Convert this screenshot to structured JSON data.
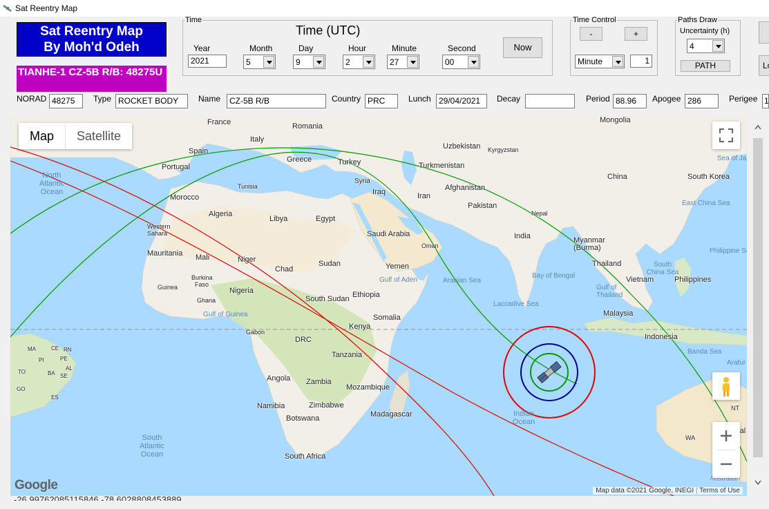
{
  "window": {
    "title": "Sat Reentry Map"
  },
  "header": {
    "app_title_line1": "Sat Reentry Map",
    "app_title_line2": "By Moh'd Odeh",
    "satellite": "TIANHE-1 CZ-5B R/B: 48275U"
  },
  "time": {
    "group_label": "Time",
    "heading": "Time (UTC)",
    "year_label": "Year",
    "year": "2021",
    "month_label": "Month",
    "month": "5",
    "day_label": "Day",
    "day": "9",
    "hour_label": "Hour",
    "hour": "2",
    "minute_label": "Minute",
    "minute": "27",
    "second_label": "Second",
    "second": "00",
    "now_button": "Now"
  },
  "time_control": {
    "group_label": "Time Control",
    "minus": "-",
    "plus": "+",
    "unit": "Minute",
    "step": "1"
  },
  "paths": {
    "group_label": "Paths Draw",
    "uncertainty_label": "Uncertainty (h)",
    "uncertainty": "4",
    "path_button": "PATH",
    "clipped_button": "Lo"
  },
  "info": {
    "norad_label": "NORAD",
    "norad": "48275",
    "type_label": "Type",
    "type": "ROCKET BODY",
    "name_label": "Name",
    "name": "CZ-5B R/B",
    "country_label": "Country",
    "country": "PRC",
    "launch_label": "Lunch",
    "launch": "29/04/2021",
    "decay_label": "Decay",
    "decay": "",
    "period_label": "Period",
    "period": "88.96",
    "apogee_label": "Apogee",
    "apogee": "286",
    "perigee_label": "Perigee",
    "perigee": "1"
  },
  "map": {
    "type_map": "Map",
    "type_satellite": "Satellite",
    "attribution": "Map data ©2021 Google, INEGI",
    "terms": "Terms of Use",
    "google": "Google",
    "track_colors": {
      "red": "#e00000",
      "green": "#009a00",
      "blue": "#00008b"
    },
    "labels": {
      "france": "France",
      "romania": "Romania",
      "mongolia": "Mongolia",
      "uzbekistan": "Uzbekistan",
      "kyrgyzstan": "Kyrgyzstan",
      "spain": "Spain",
      "italy": "Italy",
      "portugal": "Portugal",
      "greece": "Greece",
      "turkey": "Turkey",
      "turkmenistan": "Turkmenistan",
      "china": "China",
      "south_korea": "South Korea",
      "sea_of_japan": "Sea of Ja",
      "syria": "Syria",
      "tunisia": "Tunisia",
      "iraq": "Iraq",
      "afghanistan": "Afghanistan",
      "iran": "Iran",
      "morocco": "Morocco",
      "pakistan": "Pakistan",
      "east_china_sea": "East China Sea",
      "algeria": "Algeria",
      "libya": "Libya",
      "egypt": "Egypt",
      "nepal": "Nepal",
      "western_sahara": "Western Sahara",
      "saudi_arabia": "Saudi Arabia",
      "india": "India",
      "myanmar": "Myanmar (Burma)",
      "oman": "Oman",
      "philippine_sea": "Philippine Se",
      "mauritania": "Mauritania",
      "mali": "Mali",
      "niger": "Niger",
      "sudan": "Sudan",
      "thailand": "Thailand",
      "chad": "Chad",
      "yemen": "Yemen",
      "south_china_sea": "South China Sea",
      "burkina_faso": "Burkina Faso",
      "bay_of_bengal": "Bay of Bengal",
      "philippines": "Philippines",
      "gulf_of_aden": "Gulf of Aden",
      "arabian_sea": "Arabian Sea",
      "vietnam": "Vietnam",
      "guinea": "Guinea",
      "nigeria": "Nigeria",
      "ethiopia": "Ethiopia",
      "gulf_of_thailand": "Gulf of Thailand",
      "ghana": "Ghana",
      "south_sudan": "South Sudan",
      "laccadive_sea": "Laccadive Sea",
      "gulf_of_guinea": "Gulf of Guinea",
      "somalia": "Somalia",
      "malaysia": "Malaysia",
      "kenya": "Kenya",
      "gabon": "Gabon",
      "drc": "DRC",
      "indonesia": "Indonesia",
      "tanzania": "Tanzania",
      "banda_sea": "Banda Sea",
      "arafura": "Arafur",
      "angola": "Angola",
      "zambia": "Zambia",
      "mozambique": "Mozambique",
      "zimbabwe": "Zimbabwe",
      "namibia": "Namibia",
      "madagascar": "Madagascar",
      "botswana": "Botswana",
      "south_africa": "South Africa",
      "nt": "NT",
      "wa": "WA",
      "ral": "ral",
      "australian": "Australian",
      "north_atlantic": "North Atlantic Ocean",
      "south_atlantic": "South Atlantic Ocean",
      "indian_ocean": "Indian Ocean",
      "br_ma": "MA",
      "br_ce": "CE",
      "br_rn": "RN",
      "br_pi": "PI",
      "br_pe": "PE",
      "br_al": "AL",
      "br_to": "TO",
      "br_ba": "BA",
      "br_se": "SE",
      "br_go": "GO",
      "br_es": "ES"
    }
  },
  "status": {
    "coordinates": "-26.99762085115846 -78.6028808453889"
  }
}
